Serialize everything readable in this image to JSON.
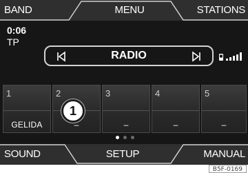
{
  "top_bar": {
    "left_tab": "BAND",
    "center_tab": "MENU",
    "right_tab": "STATIONS"
  },
  "status": {
    "time": "0:06",
    "traffic_program": "TP"
  },
  "source": {
    "label": "RADIO",
    "prev_icon": "skip-previous-icon",
    "next_icon": "skip-next-icon"
  },
  "indicators": {
    "phone_icon": "mobile-phone-icon",
    "signal_icon": "signal-strength-icon"
  },
  "presets": [
    {
      "number": "1",
      "name": "GELIDA"
    },
    {
      "number": "2",
      "name": "–"
    },
    {
      "number": "3",
      "name": "–"
    },
    {
      "number": "4",
      "name": "–"
    },
    {
      "number": "5",
      "name": "–"
    }
  ],
  "page_indicator": {
    "pages": 3,
    "current": 1
  },
  "callout": {
    "label": "1"
  },
  "bottom_bar": {
    "left_tab": "SOUND",
    "center_tab": "SETUP",
    "right_tab": "MANUAL"
  },
  "figure_code": "B5F-0169",
  "colors": {
    "screen_bg": "#161616",
    "tab_bg": "#2f2f2f",
    "tab_line": "#cfcfcf",
    "text": "#ffffff"
  }
}
